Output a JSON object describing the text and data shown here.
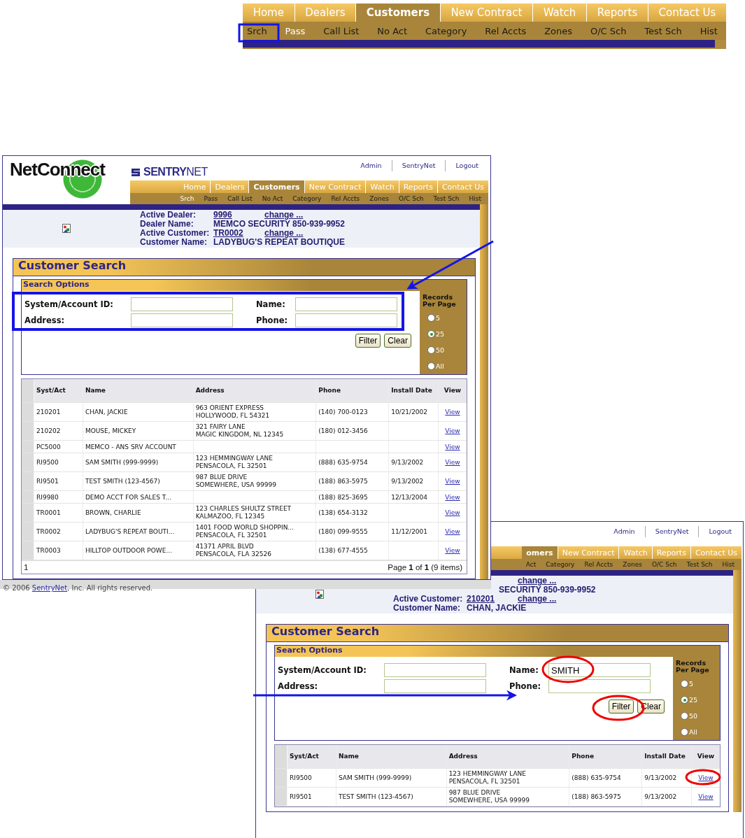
{
  "top_nav": {
    "tabs": [
      {
        "label": "Home",
        "selected": false
      },
      {
        "label": "Dealers",
        "selected": false
      },
      {
        "label": "Customers",
        "selected": true
      },
      {
        "label": "New Contract",
        "selected": false
      },
      {
        "label": "Watch",
        "selected": false
      },
      {
        "label": "Reports",
        "selected": false
      },
      {
        "label": "Contact Us",
        "selected": false
      }
    ],
    "subtabs": [
      {
        "label": "Srch",
        "selected": false
      },
      {
        "label": "Pass",
        "selected": true
      },
      {
        "label": "Call List",
        "selected": false
      },
      {
        "label": "No Act",
        "selected": false
      },
      {
        "label": "Category",
        "selected": false
      },
      {
        "label": "Rel Accts",
        "selected": false
      },
      {
        "label": "Zones",
        "selected": false
      },
      {
        "label": "O/C Sch",
        "selected": false
      },
      {
        "label": "Test Sch",
        "selected": false
      },
      {
        "label": "Hist",
        "selected": false
      }
    ]
  },
  "windows": [
    {
      "logo": "NetConnect",
      "brand": "**SENTRY**NET",
      "header_links": [
        "Admin",
        "SentryNet",
        "Logout"
      ],
      "tabs": [
        {
          "label": "Home",
          "selected": false
        },
        {
          "label": "Dealers",
          "selected": false
        },
        {
          "label": "Customers",
          "selected": true
        },
        {
          "label": "New Contract",
          "selected": false
        },
        {
          "label": "Watch",
          "selected": false
        },
        {
          "label": "Reports",
          "selected": false
        },
        {
          "label": "Contact Us",
          "selected": false
        }
      ],
      "subtabs": [
        {
          "label": "Srch",
          "selected": true
        },
        {
          "label": "Pass",
          "selected": false
        },
        {
          "label": "Call List",
          "selected": false
        },
        {
          "label": "No Act",
          "selected": false
        },
        {
          "label": "Category",
          "selected": false
        },
        {
          "label": "Rel Accts",
          "selected": false
        },
        {
          "label": "Zones",
          "selected": false
        },
        {
          "label": "O/C Sch",
          "selected": false
        },
        {
          "label": "Test Sch",
          "selected": false
        },
        {
          "label": "Hist",
          "selected": false
        }
      ],
      "info": [
        {
          "label": "Active Dealer:",
          "value": "9996",
          "kind": "link",
          "change": "change ..."
        },
        {
          "label": "Dealer Name:",
          "value": "MEMCO SECURITY 850-939-9952",
          "kind": "text"
        },
        {
          "label": "Active Customer:",
          "value": "TR0002",
          "kind": "link",
          "change": "change ..."
        },
        {
          "label": "Customer Name:",
          "value": "LADYBUG'S REPEAT BOUTIQUE",
          "kind": "text"
        }
      ],
      "panel_title": "Customer Search",
      "options_title": "Search Options",
      "fields": [
        {
          "label": "System/Account ID:"
        },
        {
          "label": "Name:"
        },
        {
          "label": "Address:"
        },
        {
          "label": "Phone:"
        }
      ],
      "records_per_page": {
        "label": "Records Per Page",
        "options": [
          {
            "label": "5",
            "selected": false
          },
          {
            "label": "25",
            "selected": true
          },
          {
            "label": "50",
            "selected": false
          },
          {
            "label": "All",
            "selected": false
          }
        ]
      },
      "buttons": [
        "Filter",
        "Clear"
      ],
      "table": {
        "columns": [
          "Syst/Act",
          "Name",
          "Address",
          "Phone",
          "Install Date",
          "View"
        ],
        "rows": [
          {
            "id": "210201",
            "name": "CHAN, JACKIE",
            "address": [
              "963 ORIENT EXPRESS",
              "HOLLYWOOD, FL 54321"
            ],
            "phone": "(140) 700-0123",
            "install_date": "10/21/2002",
            "view": "View"
          },
          {
            "id": "210202",
            "name": "MOUSE, MICKEY",
            "address": [
              "321 FAIRY LANE",
              "MAGIC KINGDOM, NL 12345"
            ],
            "phone": "(180) 012-3456",
            "view": "View"
          },
          {
            "id": "PC5000",
            "name": "MEMCO - ANS SRV ACCOUNT",
            "view": "View"
          },
          {
            "id": "RI9500",
            "name": "SAM SMITH (999-9999)",
            "address": [
              "123 HEMMINGWAY LANE",
              "PENSACOLA, FL 32501"
            ],
            "phone": "(888) 635-9754",
            "install_date": "9/13/2002",
            "view": "View"
          },
          {
            "id": "RI9501",
            "name": "TEST SMITH (123-4567)",
            "address": [
              "987 BLUE DRIVE",
              "SOMEWHERE, USA 99999"
            ],
            "phone": "(188) 863-5975",
            "install_date": "9/13/2002",
            "view": "View"
          },
          {
            "id": "RI9980",
            "name": "DEMO ACCT FOR SALES T...",
            "phone": "(188) 825-3695",
            "install_date": "12/13/2004",
            "view": "View"
          },
          {
            "id": "TR0001",
            "name": "BROWN, CHARLIE",
            "address": [
              "123 CHARLES SHULTZ STREET",
              "KALMAZOO, FL 12345"
            ],
            "phone": "(138) 654-3132",
            "view": "View"
          },
          {
            "id": "TR0002",
            "name": "LADYBUG'S REPEAT BOUTI...",
            "address": [
              "1401 FOOD WORLD SHOPPIN...",
              "PENSACOLA, FL 32501"
            ],
            "phone": "(180) 099-9555",
            "install_date": "11/12/2001",
            "view": "View"
          },
          {
            "id": "TR0003",
            "name": "HILLTOP OUTDOOR POWE...",
            "address": [
              "41371 APRIL BLVD",
              "PENSACOLA, FLA 32526"
            ],
            "phone": "(138) 677-4555",
            "view": "View"
          }
        ],
        "pager": {
          "page_number": "1",
          "summary": "Page **1** of **1** (9 items)"
        }
      },
      "footer": {
        "before": "© 2006 ",
        "link": "SentryNet",
        "after": ", Inc. All rights reserved."
      }
    },
    {
      "header_links": [
        "Admin",
        "SentryNet",
        "Logout"
      ],
      "tabs": [
        {
          "label": "omers",
          "selected": true
        },
        {
          "label": "New Contract",
          "selected": false
        },
        {
          "label": "Watch",
          "selected": false
        },
        {
          "label": "Reports",
          "selected": false
        },
        {
          "label": "Contact Us",
          "selected": false
        }
      ],
      "subtabs": [
        {
          "label": "Act",
          "selected": false
        },
        {
          "label": "Category",
          "selected": false
        },
        {
          "label": "Rel Accts",
          "selected": false
        },
        {
          "label": "Zones",
          "selected": false
        },
        {
          "label": "O/C Sch",
          "selected": false
        },
        {
          "label": "Test Sch",
          "selected": false
        },
        {
          "label": "Hist",
          "selected": false
        }
      ],
      "info": [
        {
          "change": "change ..."
        },
        {
          "value": "SECURITY 850-939-9952",
          "kind": "text"
        },
        {
          "label": "Active Customer:",
          "value": "210201",
          "kind": "link",
          "change": "change ..."
        },
        {
          "label": "Customer Name:",
          "value": "CHAN, JACKIE",
          "kind": "text"
        }
      ],
      "panel_title": "Customer Search",
      "options_title": "Search Options",
      "fields": [
        {
          "label": "System/Account ID:"
        },
        {
          "label": "Name:",
          "value": "SMITH"
        },
        {
          "label": "Address:"
        },
        {
          "label": "Phone:"
        }
      ],
      "records_per_page": {
        "label": "Records Per Page",
        "options": [
          {
            "label": "5",
            "selected": false
          },
          {
            "label": "25",
            "selected": true
          },
          {
            "label": "50",
            "selected": false
          },
          {
            "label": "All",
            "selected": false
          }
        ]
      },
      "buttons": [
        "Filter",
        "Clear"
      ],
      "table": {
        "columns": [
          "Syst/Act",
          "Name",
          "Address",
          "Phone",
          "Install Date",
          "View"
        ],
        "rows": [
          {
            "id": "RI9500",
            "name": "SAM SMITH (999-9999)",
            "address": [
              "123 HEMMINGWAY LANE",
              "PENSACOLA, FL 32501"
            ],
            "phone": "(888) 635-9754",
            "install_date": "9/13/2002",
            "view": "View"
          },
          {
            "id": "RI9501",
            "name": "TEST SMITH (123-4567)",
            "address": [
              "987 BLUE DRIVE",
              "SOMEWHERE, USA 99999"
            ],
            "phone": "(188) 863-5975",
            "install_date": "9/13/2002",
            "view": "View"
          }
        ]
      }
    }
  ]
}
